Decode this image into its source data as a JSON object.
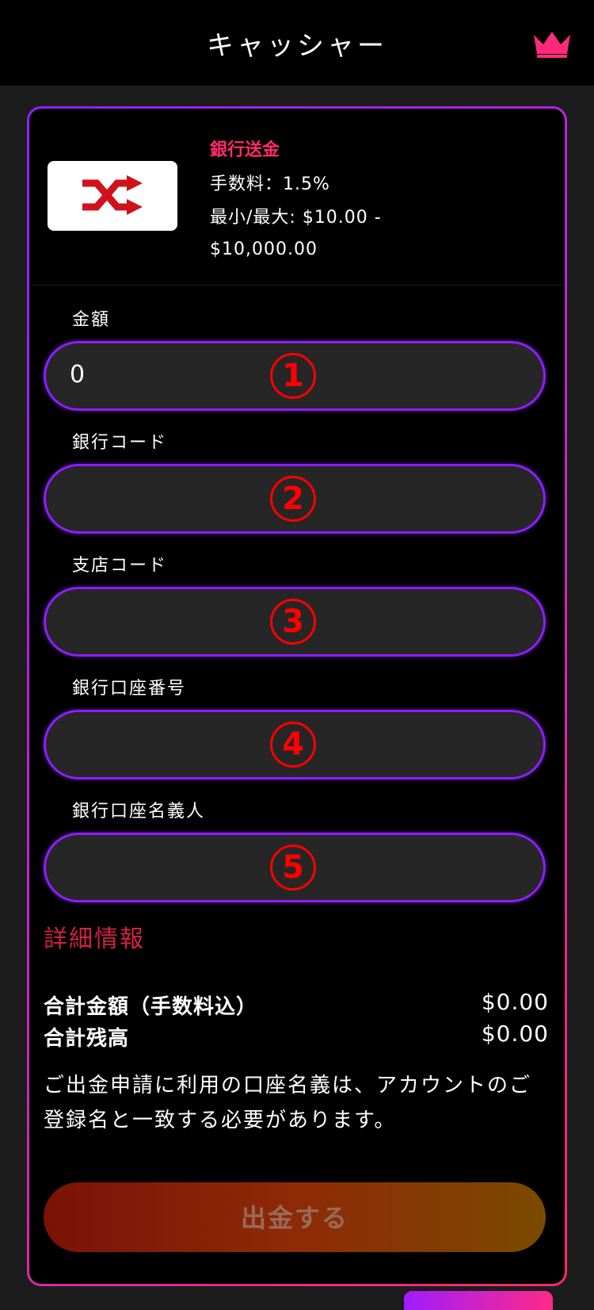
{
  "header": {
    "title": "キャッシャー"
  },
  "method": {
    "name": "銀行送金",
    "fee": "手数料：1.5%",
    "limits": "最小/最大: $10.00 - $10,000.00",
    "logo_icon": "shuffle-icon"
  },
  "form": {
    "fields": [
      {
        "label": "金額",
        "value": "0",
        "marker": "1"
      },
      {
        "label": "銀行コード",
        "value": "",
        "marker": "2"
      },
      {
        "label": "支店コード",
        "value": "",
        "marker": "3"
      },
      {
        "label": "銀行口座番号",
        "value": "",
        "marker": "4"
      },
      {
        "label": "銀行口座名義人",
        "value": "",
        "marker": "5"
      }
    ]
  },
  "details_link": "詳細情報",
  "totals": {
    "total_amount_label": "合計金額（手数料込）",
    "total_amount_value": "$0.00",
    "total_balance_label": "合計残高",
    "total_balance_value": "$0.00"
  },
  "notice": "ご出金申請に利用の口座名義は、アカウントのご登録名と一致する必要があります。",
  "submit_label": "出金する",
  "colors": {
    "accent_pink": "#ff2a6a",
    "accent_purple": "#8d1dff",
    "marker_red": "#ff0000"
  }
}
